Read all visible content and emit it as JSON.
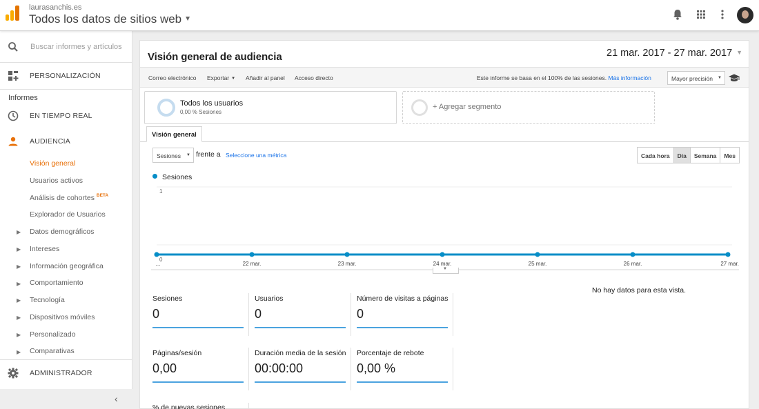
{
  "header": {
    "account": "laurasanchis.es",
    "property": "Todos los datos de sitios web",
    "property_caret": "▼"
  },
  "sidebar": {
    "search_placeholder": "Buscar informes y artículos",
    "customization": "PERSONALIZACIÓN",
    "reports_title": "Informes",
    "realtime": "EN TIEMPO REAL",
    "audience": "AUDIENCIA",
    "audience_items": [
      "Visión general",
      "Usuarios activos",
      "Análisis de cohortes",
      "Explorador de Usuarios"
    ],
    "beta": "BETA",
    "expandable": [
      "Datos demográficos",
      "Intereses",
      "Información geográfica",
      "Comportamiento",
      "Tecnología",
      "Dispositivos móviles",
      "Personalizado",
      "Comparativas"
    ],
    "expand_arrow": "▶",
    "admin": "ADMINISTRADOR",
    "collapse": "‹"
  },
  "report": {
    "title": "Visión general de audiencia",
    "date_range": "21 mar. 2017 - 27 mar. 2017",
    "date_caret": "▼",
    "toolbar": {
      "email": "Correo electrónico",
      "export": "Exportar",
      "add_to_dashboard": "Añadir al panel",
      "shortcut": "Acceso directo",
      "caret": "▼",
      "sample_note": "Este informe se basa en el 100% de las sesiones.",
      "more_info": "Más información",
      "precision": "Mayor precisión"
    },
    "segment": {
      "name": "Todos los usuarios",
      "pct": "0,00 % Sesiones",
      "add": "+ Agregar segmento"
    },
    "tab": "Visión general",
    "metric_select": "Sesiones",
    "versus": "frente a",
    "select_metric": "Seleccione una métrica",
    "granularity": [
      "Cada hora",
      "Día",
      "Semana",
      "Mes"
    ],
    "active_granularity": "Día",
    "no_data": "No hay datos para esta vista.",
    "metrics": [
      {
        "label": "Sesiones",
        "value": "0"
      },
      {
        "label": "Usuarios",
        "value": "0"
      },
      {
        "label": "Número de visitas a páginas",
        "value": "0"
      },
      {
        "label": "Páginas/sesión",
        "value": "0,00"
      },
      {
        "label": "Duración media de la sesión",
        "value": "00:00:00"
      },
      {
        "label": "Porcentaje de rebote",
        "value": "0,00 %"
      }
    ],
    "new_sessions_label": "% de nuevas sesiones"
  },
  "chart_data": {
    "type": "line",
    "x": [
      "…",
      "22 mar.",
      "23 mar.",
      "24 mar.",
      "25 mar.",
      "26 mar.",
      "27 mar."
    ],
    "series": [
      {
        "name": "Sesiones",
        "values": [
          0,
          0,
          0,
          0,
          0,
          0,
          0
        ]
      }
    ],
    "ylim": [
      0,
      1
    ],
    "yticks": [
      "1",
      "0"
    ],
    "color": "#058dc7",
    "grid": true
  },
  "colors": {
    "accent": "#e8710a",
    "series": "#058dc7",
    "link": "#1a73e8"
  }
}
